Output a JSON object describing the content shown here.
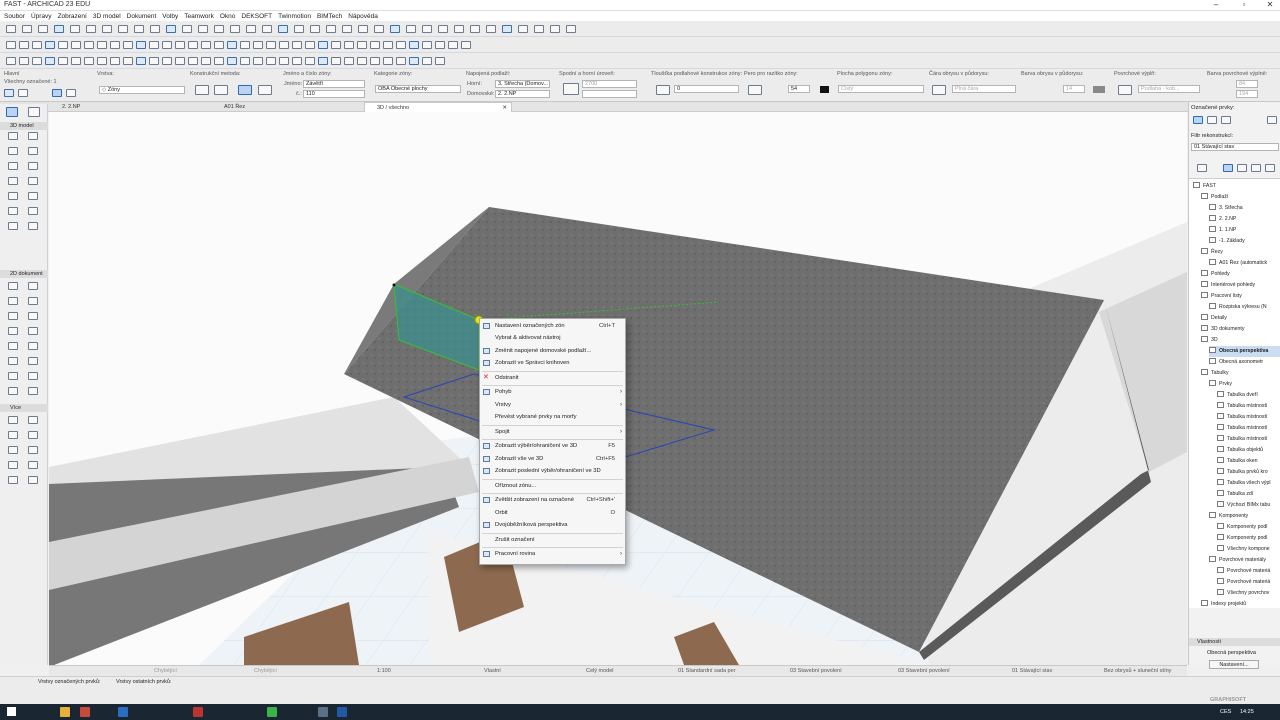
{
  "window": {
    "title": "FAST - ARCHICAD 23 EDU"
  },
  "menu": [
    "Soubor",
    "Úpravy",
    "Zobrazení",
    "3D model",
    "Dokument",
    "Volby",
    "Teamwork",
    "Okno",
    "DEKSOFT",
    "Twinmotion",
    "BIMTech",
    "Nápověda"
  ],
  "infobox": {
    "c1_label": "Hlavní",
    "c1_sub": "Všechny označené: 1",
    "c2_label": "Vrstva:",
    "c2_value": "Zóny",
    "c3_label": "Konstrukční metoda:",
    "c4_label": "Jméno a číslo zóny:",
    "name_label": "Jméno:",
    "name_value": "Závětří",
    "num_label": "č.:",
    "num_value": "110",
    "c5_label": "Kategorie zóny:",
    "c5_value": "OBA  Obecné plochy",
    "c6_label": "Napojená podlaží:",
    "upper_label": "Horní:",
    "upper_value": "3. Střecha (Domov...",
    "home_label": "Domovské:",
    "home_value": "2. 2.NP",
    "c7_label": "Spodní a horní úroveň:",
    "c7_value": "2700",
    "c8_label": "Tloušťka podlahové konstrukce zóny:",
    "c8_value": "0",
    "c9_label": "Pero pro razítko zóny:",
    "c9_value": "54",
    "c10_label": "Plocha polygonu zóny:",
    "c10_value": "Čistý",
    "c11_label": "Čára obrysu v půdorysu:",
    "c11_value": "Plná čára",
    "c12_label": "Barva obrysu v půdorysu:",
    "c12_value": "14",
    "c13_label": "Povrchové výplň:",
    "c13_value": "Podlaha - kob...",
    "c14_label": "Barva povrchové výplně:",
    "c14_v1": "84",
    "c14_v2": "194"
  },
  "tabs": [
    "2. 2.NP",
    "A01 Řez",
    "3D / všechno"
  ],
  "toolbox": {
    "sections": [
      "3D model",
      "2D dokument",
      "Více"
    ]
  },
  "context_menu": {
    "items": [
      {
        "label": "Nastavení označených zón",
        "shortcut": "Ctrl+T",
        "arrow": ""
      },
      {
        "label": "Vybrat & aktivovat nástroj",
        "shortcut": "",
        "arrow": ""
      },
      {
        "label": "Změnit napojené domovské podlaží...",
        "shortcut": "",
        "arrow": ""
      },
      {
        "label": "Zobrazit ve Správci knihoven",
        "shortcut": "",
        "arrow": ""
      },
      {
        "label": "Odstranit",
        "shortcut": "",
        "arrow": ""
      },
      {
        "label": "Pohyb",
        "shortcut": "",
        "arrow": "›"
      },
      {
        "label": "Vrstvy",
        "shortcut": "",
        "arrow": "›"
      },
      {
        "label": "Převést vybrané prvky na morfy",
        "shortcut": "",
        "arrow": ""
      },
      {
        "label": "Spojit",
        "shortcut": "",
        "arrow": "›"
      },
      {
        "label": "Zobrazit výběr/ohraničení ve 3D",
        "shortcut": "F5",
        "arrow": ""
      },
      {
        "label": "Zobrazit vše ve 3D",
        "shortcut": "Ctrl+F5",
        "arrow": ""
      },
      {
        "label": "Zobrazit poslední výběr/ohraničení ve 3D",
        "shortcut": "",
        "arrow": ""
      },
      {
        "label": "Oříznout zónu...",
        "shortcut": "",
        "arrow": ""
      },
      {
        "label": "Zvětšit zobrazení na označené",
        "shortcut": "Ctrl+Shift+'",
        "arrow": ""
      },
      {
        "label": "Orbit",
        "shortcut": "O",
        "arrow": ""
      },
      {
        "label": "Dvojúběžníková perspektiva",
        "shortcut": "",
        "arrow": ""
      },
      {
        "label": "Zrušit označení",
        "shortcut": "",
        "arrow": ""
      },
      {
        "label": "Pracovní rovina",
        "shortcut": "",
        "arrow": "›"
      }
    ]
  },
  "right_panel": {
    "header": "Označené prvky:",
    "filter_label": "Filtr rekonstrukcí:",
    "filter_value": "01 Stávající stav",
    "tree": [
      {
        "label": "FAST",
        "level": 0
      },
      {
        "label": "Podlaží",
        "level": 1
      },
      {
        "label": "3. Střecha",
        "level": 2
      },
      {
        "label": "2. 2.NP",
        "level": 2
      },
      {
        "label": "1. 1.NP",
        "level": 2
      },
      {
        "label": "-1. Základy",
        "level": 2
      },
      {
        "label": "Řezy",
        "level": 1
      },
      {
        "label": "A01 Řez (automatick",
        "level": 2
      },
      {
        "label": "Pohledy",
        "level": 1
      },
      {
        "label": "Interiérové pohledy",
        "level": 1
      },
      {
        "label": "Pracovní listy",
        "level": 1
      },
      {
        "label": "Rozpiska výkresu (N",
        "level": 2
      },
      {
        "label": "Detaily",
        "level": 1
      },
      {
        "label": "3D dokumenty",
        "level": 1
      },
      {
        "label": "3D",
        "level": 1
      },
      {
        "label": "Obecná perspektiva",
        "level": 2
      },
      {
        "label": "Obecná axonometr",
        "level": 2
      },
      {
        "label": "Tabulky",
        "level": 1
      },
      {
        "label": "Prvky",
        "level": 2
      },
      {
        "label": "Tabulka dveří",
        "level": 3
      },
      {
        "label": "Tabulka místností",
        "level": 3
      },
      {
        "label": "Tabulka místností",
        "level": 3
      },
      {
        "label": "Tabulka místností",
        "level": 3
      },
      {
        "label": "Tabulka místností",
        "level": 3
      },
      {
        "label": "Tabulka objektů",
        "level": 3
      },
      {
        "label": "Tabulka oken",
        "level": 3
      },
      {
        "label": "Tabulka prvků kro",
        "level": 3
      },
      {
        "label": "Tabulka všech výpl",
        "level": 3
      },
      {
        "label": "Tabulka zdí",
        "level": 3
      },
      {
        "label": "Výchozí BIMx tabu",
        "level": 3
      },
      {
        "label": "Komponenty",
        "level": 2
      },
      {
        "label": "Komponenty podl",
        "level": 3
      },
      {
        "label": "Komponenty podl",
        "level": 3
      },
      {
        "label": "Všechny kompone",
        "level": 3
      },
      {
        "label": "Povrchové materiály",
        "level": 2
      },
      {
        "label": "Povrchové materiá",
        "level": 3
      },
      {
        "label": "Povrchové materiá",
        "level": 3
      },
      {
        "label": "Všechny povrchov",
        "level": 3
      },
      {
        "label": "Indexy projektů",
        "level": 1
      }
    ],
    "props_header": "Vlastnosti",
    "props_value": "Obecná perspektiva",
    "settings_button": "Nastavení..."
  },
  "statusbar": {
    "scale": "1:100",
    "view": "Vlastní",
    "model": "Celý model",
    "pen_set": "01 Standardní sada per",
    "mvo1": "03 Stavební povolení",
    "mvo2": "03 Stavební povolení",
    "phase": "01 Stávající stav",
    "render": "Bez obrysů + sluneční stíny",
    "missing": "Chybějící"
  },
  "bottom": {
    "layers_selected": "Vrstvy označených prvků:",
    "layers_other": "Vrstvy ostatních prvků:",
    "graphisoft": "GRAPHISOFT"
  },
  "taskbar": {
    "lang": "CES",
    "time": "14:25"
  }
}
